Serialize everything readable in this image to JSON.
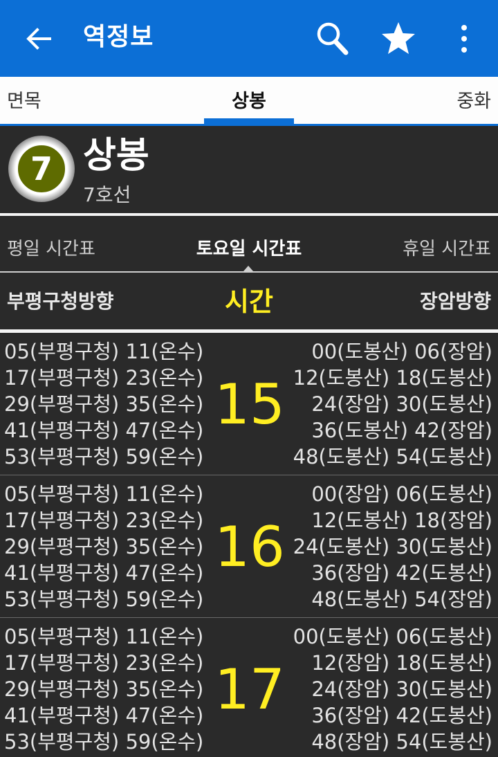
{
  "appbar": {
    "title": "역정보",
    "icons": [
      "arrow-back-icon",
      "search-icon",
      "star-icon",
      "more-vert-icon"
    ],
    "accent_color": "#0c6fd6"
  },
  "station_tabs": {
    "prev": "면목",
    "current": "상봉",
    "next": "중화"
  },
  "station": {
    "line_number": "7",
    "name": "상봉",
    "line_name": "7호선",
    "line_color": "#5e6b00"
  },
  "day_tabs": {
    "weekday": "평일 시간표",
    "saturday": "토요일 시간표",
    "holiday": "휴일 시간표",
    "selected": "토요일 시간표"
  },
  "columns": {
    "left": "부평구청방향",
    "middle": "시간",
    "right": "장암방향"
  },
  "timetable": [
    {
      "hour": "15",
      "left": [
        "05(부평구청) 11(온수)",
        "17(부평구청) 23(온수)",
        "29(부평구청) 35(온수)",
        "41(부평구청) 47(온수)",
        "53(부평구청) 59(온수)"
      ],
      "right": [
        "00(도봉산) 06(장암)",
        "12(도봉산) 18(도봉산)",
        "24(장암) 30(도봉산)",
        "36(도봉산) 42(장암)",
        "48(도봉산) 54(도봉산)"
      ]
    },
    {
      "hour": "16",
      "left": [
        "05(부평구청) 11(온수)",
        "17(부평구청) 23(온수)",
        "29(부평구청) 35(온수)",
        "41(부평구청) 47(온수)",
        "53(부평구청) 59(온수)"
      ],
      "right": [
        "00(장암) 06(도봉산)",
        "12(도봉산) 18(장암)",
        "24(도봉산) 30(도봉산)",
        "36(장암) 42(도봉산)",
        "48(도봉산) 54(장암)"
      ]
    },
    {
      "hour": "17",
      "left": [
        "05(부평구청) 11(온수)",
        "17(부평구청) 23(온수)",
        "29(부평구청) 35(온수)",
        "41(부평구청) 47(온수)",
        "53(부평구청) 59(온수)"
      ],
      "right": [
        "00(도봉산) 06(도봉산)",
        "12(장암) 18(도봉산)",
        "24(장암) 30(도봉산)",
        "36(장암) 42(도봉산)",
        "48(장암) 54(도봉산)"
      ]
    }
  ]
}
